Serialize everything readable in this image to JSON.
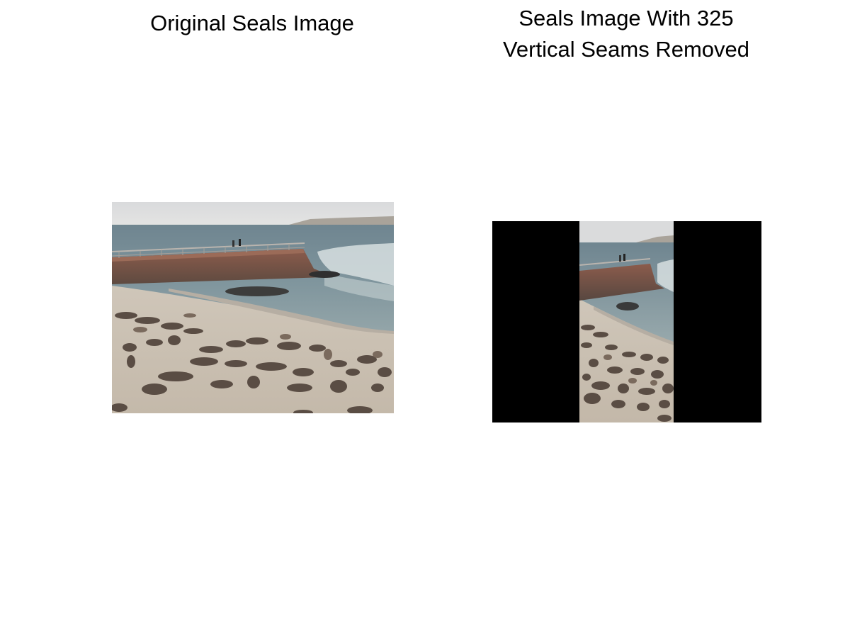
{
  "figure": {
    "left_panel": {
      "title": "Original Seals Image",
      "image_description": "seals-on-beach-photo"
    },
    "right_panel": {
      "title_line_1": "Seals Image With 325",
      "title_line_2": "Vertical Seams Removed",
      "image_description": "seam-carved-seals-photo"
    }
  }
}
